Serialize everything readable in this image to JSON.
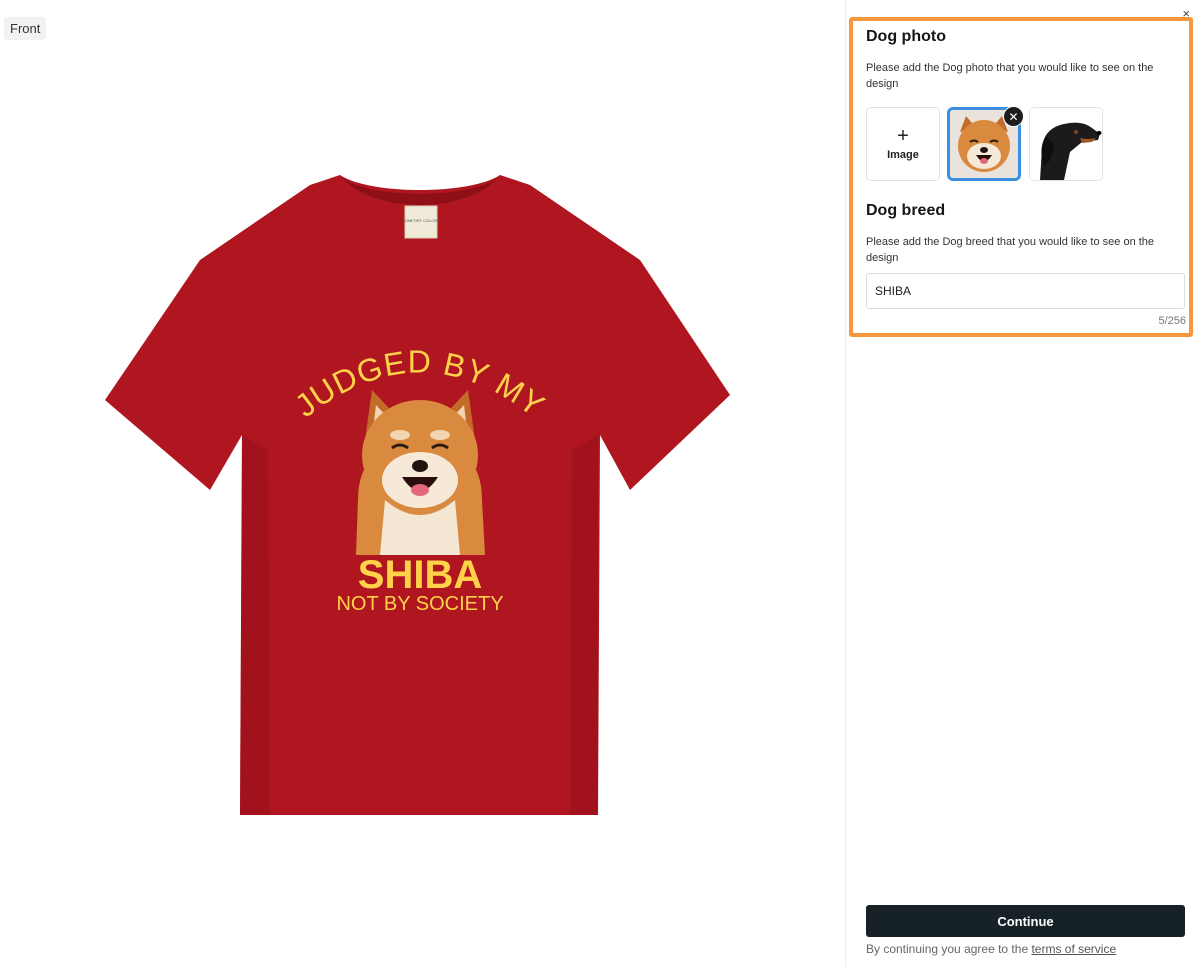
{
  "preview": {
    "view_label": "Front",
    "design": {
      "line1": "JUDGED BY MY",
      "line2": "SHIBA",
      "line3": "NOT BY SOCIETY",
      "shirt_color": "#b0161f",
      "text_color": "#ffd24a",
      "tag_text": "COMFORT COLORS"
    }
  },
  "panel": {
    "close_icon": "×",
    "dog_photo": {
      "title": "Dog photo",
      "description": "Please add the Dog photo that you would like to see on the design",
      "add_plus": "+",
      "add_label": "Image",
      "remove_icon": "✕"
    },
    "dog_breed": {
      "title": "Dog breed",
      "description": "Please add the Dog breed that you would like to see on the design",
      "value": "SHIBA",
      "counter": "5/256"
    },
    "continue_label": "Continue",
    "terms_prefix": "By continuing you agree to the ",
    "terms_link": "terms of service"
  },
  "colors": {
    "highlight": "#f7963a",
    "selected_border": "#3b8fe0",
    "continue_bg": "#172226"
  }
}
